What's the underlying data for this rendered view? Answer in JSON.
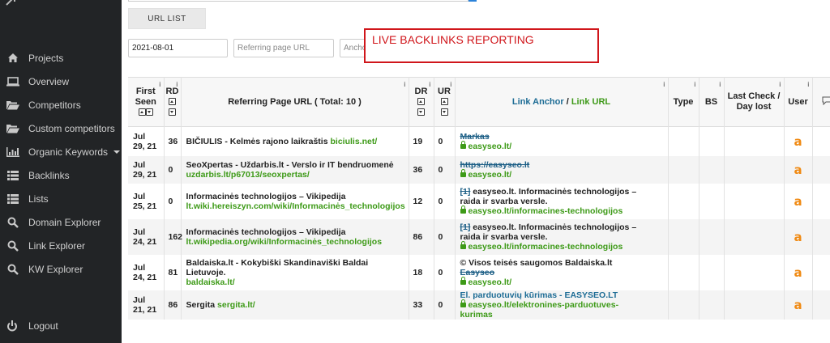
{
  "sidebar": {
    "items": [
      {
        "label": "Projects",
        "icon": "home-icon"
      },
      {
        "label": "Overview",
        "icon": "monitor-icon"
      },
      {
        "label": "Competitors",
        "icon": "folder-open-icon"
      },
      {
        "label": "Custom competitors",
        "icon": "folder-open-icon"
      },
      {
        "label": "Organic Keywords",
        "icon": "bar-chart-icon"
      },
      {
        "label": "Backlinks",
        "icon": "list-icon"
      },
      {
        "label": "Lists",
        "icon": "list-icon"
      },
      {
        "label": "Domain Explorer",
        "icon": "search-icon"
      },
      {
        "label": "Link Explorer",
        "icon": "search-icon"
      },
      {
        "label": "KW Explorer",
        "icon": "search-icon"
      }
    ],
    "logout": "Logout"
  },
  "toolbar": {
    "url_list": "URL LIST",
    "date_value": "2021-08-01",
    "ref_placeholder": "Referring page URL",
    "anchor_placeholder": "Ancho"
  },
  "annotation": "LIVE BACKLINKS REPORTING",
  "table": {
    "headers": {
      "first_seen_1": "First",
      "first_seen_2": "Seen",
      "rd": "RD",
      "ref_page": "Referring Page URL ( Total: 10 )",
      "dr": "DR",
      "ur": "UR",
      "link_anchor": "Link Anchor",
      "slash": " / ",
      "link_url": "Link URL",
      "type": "Type",
      "bs": "BS",
      "last_check_1": "Last Check /",
      "last_check_2": "Day lost",
      "user": "User",
      "info": "i"
    },
    "rows": [
      {
        "date": "Jul 29, 21",
        "rd": "36",
        "title": "BIČIULIS - Kelmės rajono laikraštis",
        "title_url": "biciulis.net/",
        "url": "",
        "dr": "19",
        "ur": "0",
        "anchor_strike": "Markas",
        "anchor_text": "",
        "anchor_text2": "",
        "anchor_blue": "",
        "anchor_note": "",
        "link_url": "easyseo.lt/",
        "link_url2": "",
        "user": "a"
      },
      {
        "date": "Jul 29, 21",
        "rd": "0",
        "title": "SeoXpertas - Uždarbis.lt - Verslo ir IT bendruomenė",
        "title_url": "",
        "url": "uzdarbis.lt/p67013/seoxpertas/",
        "dr": "36",
        "ur": "0",
        "anchor_strike": "https://easyseo.lt",
        "anchor_text": "",
        "anchor_text2": "",
        "anchor_blue": "",
        "anchor_note": "",
        "link_url": "easyseo.lt/",
        "link_url2": "",
        "user": "a"
      },
      {
        "date": "Jul 25, 21",
        "rd": "0",
        "title": "Informacinės technologijos – Vikipedija",
        "title_url": "",
        "url": "lt.wiki.hereiszyn.com/wiki/Informacinės_technologijos",
        "dr": "12",
        "ur": "0",
        "anchor_strike": "[1]",
        "anchor_text": " easyseo.lt. Informacinės technologijos –",
        "anchor_text2": "raida ir svarba versle.",
        "anchor_blue": "",
        "anchor_note": "",
        "link_url": "easyseo.lt/informacines-technologijos",
        "link_url2": "",
        "user": "a"
      },
      {
        "date": "Jul 24, 21",
        "rd": "162",
        "title": "Informacinės technologijos – Vikipedija",
        "title_url": "",
        "url": "lt.wikipedia.org/wiki/Informacinės_technologijos",
        "dr": "86",
        "ur": "0",
        "anchor_strike": "[1]",
        "anchor_text": " easyseo.lt. Informacinės technologijos –",
        "anchor_text2": "raida ir svarba versle.",
        "anchor_blue": "",
        "anchor_note": "",
        "link_url": "easyseo.lt/informacines-technologijos",
        "link_url2": "",
        "user": "a"
      },
      {
        "date": "Jul 24, 21",
        "rd": "81",
        "title": "Baldaiska.lt - Kokybiški Skandinaviški Baldai Lietuvoje.",
        "title_url": "",
        "url": "baldaiska.lt/",
        "dr": "18",
        "ur": "0",
        "anchor_strike": "Easyseo",
        "anchor_text": "",
        "anchor_text2": "",
        "anchor_blue": "",
        "anchor_note": "© Visos teisės saugomos Baldaiska.lt",
        "link_url": "easyseo.lt/",
        "link_url2": "",
        "user": "a"
      },
      {
        "date": "Jul 21, 21",
        "rd": "86",
        "title": "Sergita",
        "title_url": "sergita.lt/",
        "url": "",
        "dr": "33",
        "ur": "0",
        "anchor_strike": "",
        "anchor_text": "",
        "anchor_text2": "",
        "anchor_blue": "El. parduotuvių kūrimas - EASYSEO.LT",
        "anchor_note": "",
        "link_url": "easyseo.lt/elektronines-parduotuves-",
        "link_url2": "kurimas",
        "user": "a"
      }
    ]
  }
}
